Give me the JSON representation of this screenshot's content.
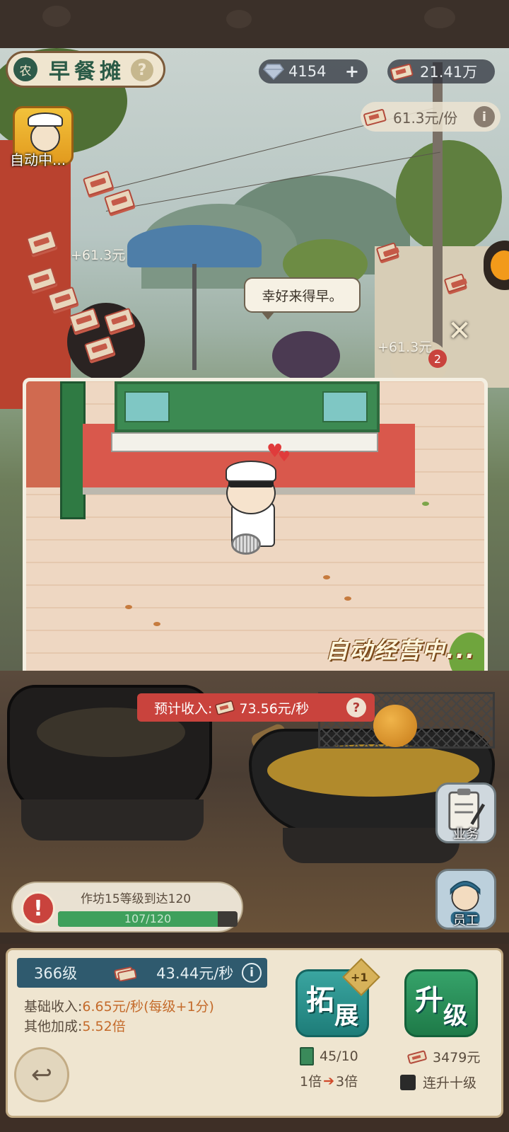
{
  "header": {
    "badge": "农",
    "title": "早餐摊",
    "help": "?",
    "gems": "4154",
    "gems_add": "+",
    "cash": "21.41万",
    "per_serve": "61.3元/份",
    "per_serve_info": "i"
  },
  "auto": {
    "label": "自动中..."
  },
  "scene": {
    "float_income_1": "+61.3元",
    "float_income_2": "+61.3元",
    "speech": "幸好来得早。",
    "queue_badge": "2",
    "close": "✕"
  },
  "popup": {
    "auto_running": "自动经营中..."
  },
  "income": {
    "label": "预计收入:",
    "value": "73.56元/秒",
    "help": "?"
  },
  "side_buttons": {
    "business": "业务",
    "staff": "员工"
  },
  "goal": {
    "text": "作坊15等级到达120",
    "progress": "107/120",
    "current": 107,
    "target": 120,
    "alert": "!"
  },
  "bottom": {
    "level": "366级",
    "rate": "43.44元/秒",
    "rate_info": "i",
    "base_label": "基础收入:",
    "base_value": "6.65元/秒(每级+1分)",
    "bonus_label": "其他加成:",
    "bonus_value": "5.52倍",
    "expand": {
      "ch1": "拓",
      "ch2": "展",
      "badge": "+1",
      "cost": "45/10",
      "mult_from": "1倍",
      "mult_to": "3倍"
    },
    "upgrade": {
      "ch1": "升",
      "ch2": "级",
      "cost": "3479元",
      "option": "连升十级"
    },
    "back": "↩"
  },
  "colors": {
    "accent_green": "#2b5b47",
    "income_red": "#c9433d",
    "progress_green": "#3fa05c",
    "level_blue": "#2f5a6e"
  }
}
